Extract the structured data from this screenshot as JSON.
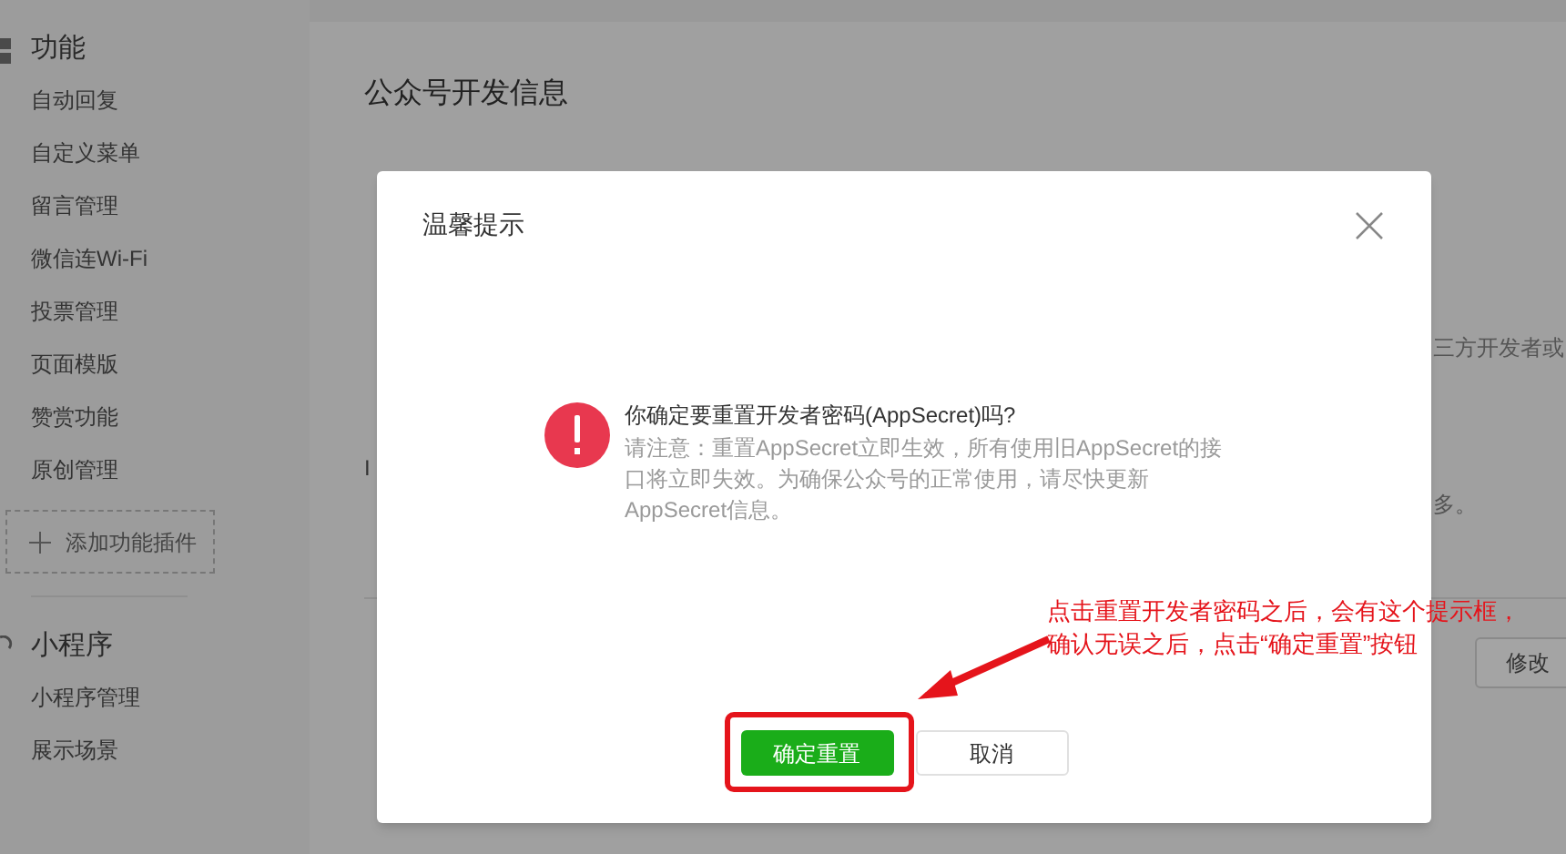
{
  "sidebar": {
    "sections": [
      {
        "title": "功能",
        "kind": "grid",
        "items": [
          "自动回复",
          "自定义菜单",
          "留言管理",
          "微信连Wi-Fi",
          "投票管理",
          "页面模版",
          "赞赏功能",
          "原创管理"
        ],
        "add_button": "添加功能插件"
      },
      {
        "title": "小程序",
        "kind": "ring",
        "items": [
          "小程序管理",
          "展示场景"
        ]
      }
    ]
  },
  "main": {
    "title": "公众号开发信息",
    "rows": [
      {
        "label": []
      },
      {
        "label": [],
        "note": "三方开发者或"
      },
      {
        "label": [
          "I"
        ],
        "note": "多。"
      }
    ],
    "section2": {
      "button": "修改"
    }
  },
  "dialog": {
    "title": "温馨提示",
    "kind": "warning",
    "question": "你确定要重置开发者密码(AppSecret)吗?",
    "notice": "请注意：重置AppSecret立即生效，所有使用旧AppSecret的接口将立即失效。为确保公众号的正常使用，请尽快更新AppSecret信息。",
    "buttons": [
      {
        "label": "确定重置",
        "primary": true
      },
      {
        "label": "取消",
        "primary": false
      }
    ]
  },
  "annotation": {
    "lines": [
      "点击重置开发者密码之后，会有这个提示框，",
      "确认无误之后，点击“确定重置”按钮"
    ]
  }
}
